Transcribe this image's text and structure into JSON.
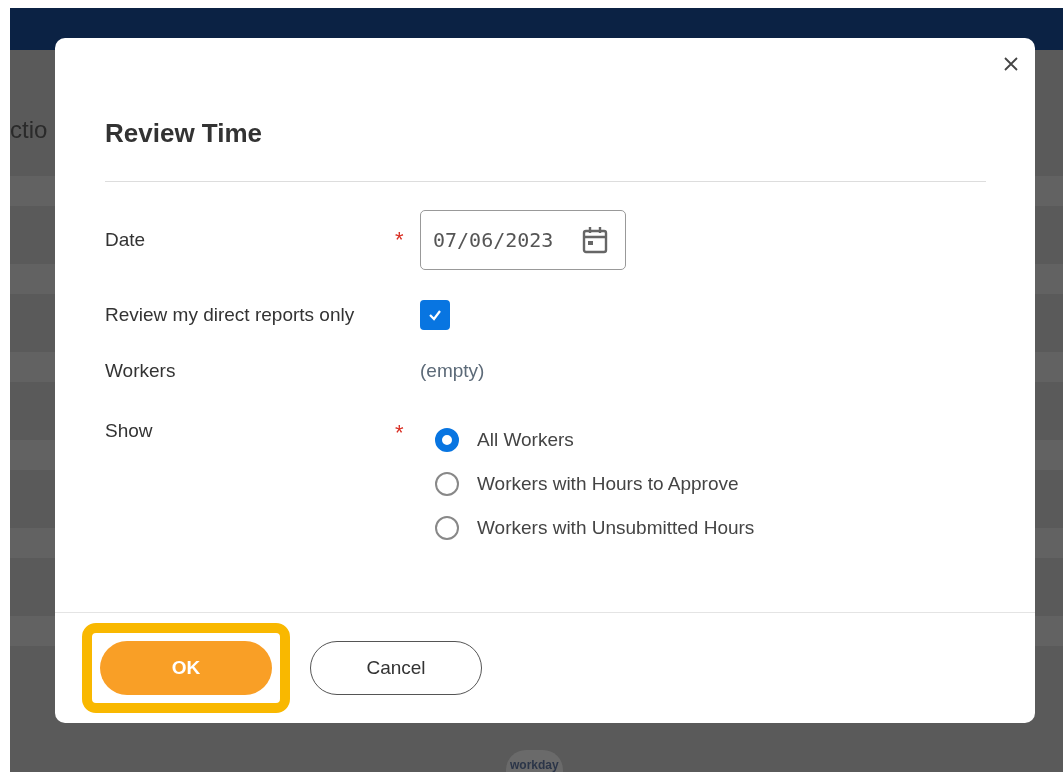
{
  "background": {
    "partial_heading": "ctio",
    "logo": "workday"
  },
  "dialog": {
    "title": "Review Time",
    "date": {
      "label": "Date",
      "required_mark": "*",
      "value": "07/06/2023"
    },
    "direct_reports": {
      "label": "Review my direct reports only",
      "checked": true
    },
    "workers": {
      "label": "Workers",
      "value": "(empty)"
    },
    "show": {
      "label": "Show",
      "required_mark": "*",
      "options": [
        {
          "label": "All Workers",
          "selected": true
        },
        {
          "label": "Workers with Hours to Approve",
          "selected": false
        },
        {
          "label": "Workers with Unsubmitted Hours",
          "selected": false
        }
      ]
    },
    "buttons": [
      {
        "label": "OK",
        "kind": "primary",
        "highlighted": true
      },
      {
        "label": "Cancel",
        "kind": "secondary",
        "highlighted": false
      }
    ]
  }
}
